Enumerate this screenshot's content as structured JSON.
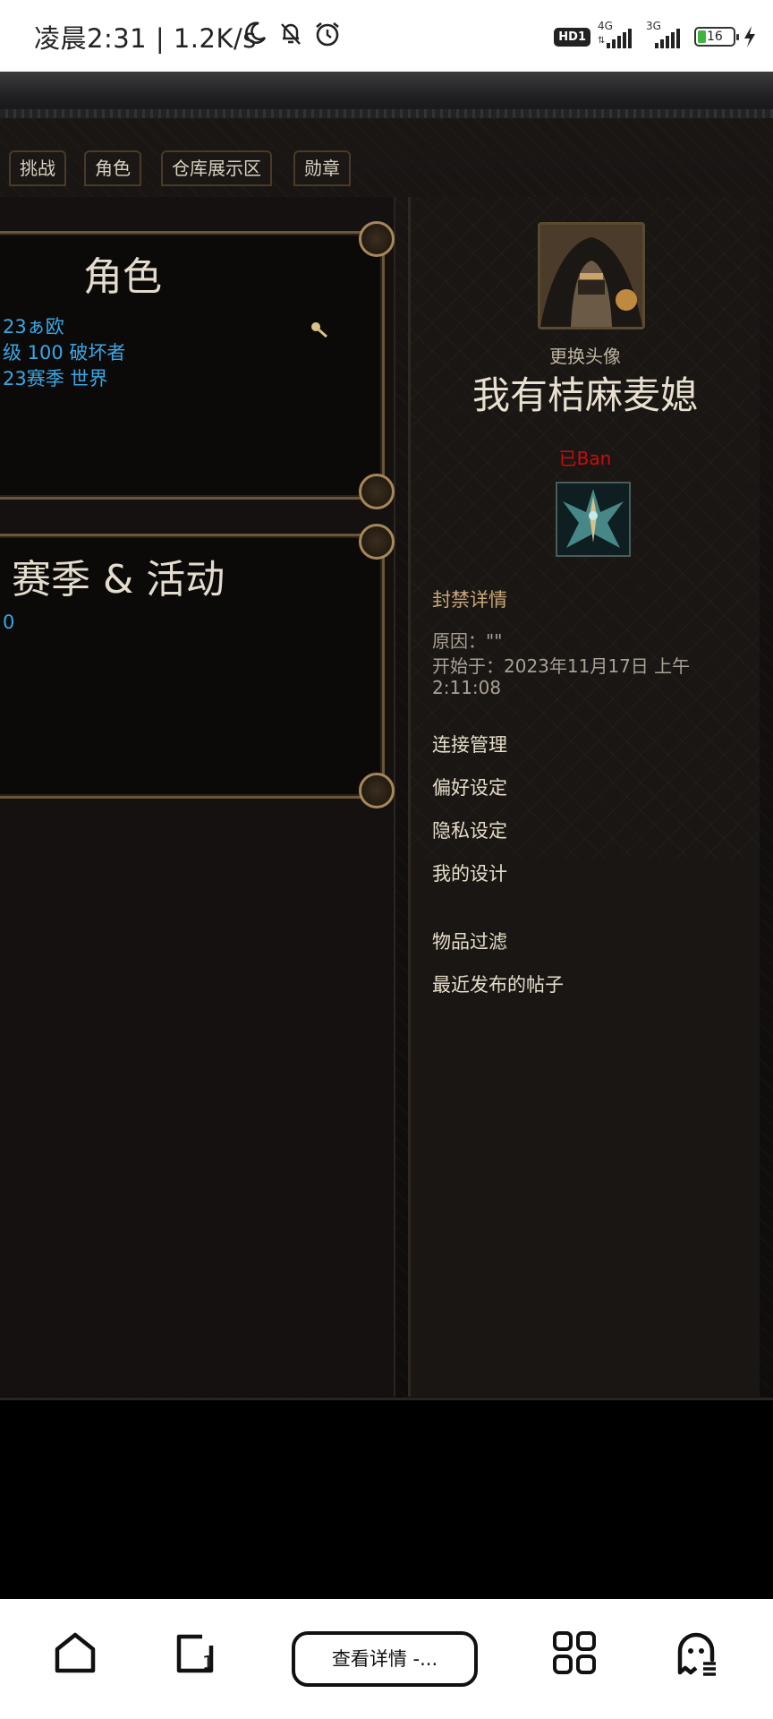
{
  "status_bar": {
    "time": "凌晨2:31 | 1.2K/s",
    "hd": "HD1",
    "net1": "4G",
    "net2": "3G",
    "battery": "16"
  },
  "tabs": [
    "挑战",
    "角色",
    "仓库展示区",
    "勋章"
  ],
  "roles_panel": {
    "title": "角色",
    "lines": [
      "23ぁ欧",
      "级 100 破坏者",
      "23赛季 世界"
    ]
  },
  "season_panel": {
    "title": "赛季 & 活动",
    "lines": [
      "0"
    ]
  },
  "profile": {
    "change_avatar": "更换头像",
    "username": "我有桔麻麦媳",
    "status": "已Ban"
  },
  "ban_details": {
    "title": "封禁详情",
    "reason": "原因：\"\"",
    "start_line1": "开始于：2023年11月17日 上午",
    "start_line2": "2:11:08"
  },
  "links": [
    "连接管理",
    "偏好设定",
    "隐私设定",
    "我的设计",
    "物品过滤",
    "最近发布的帖子"
  ],
  "nav": {
    "center_label": "查看详情 -..."
  }
}
